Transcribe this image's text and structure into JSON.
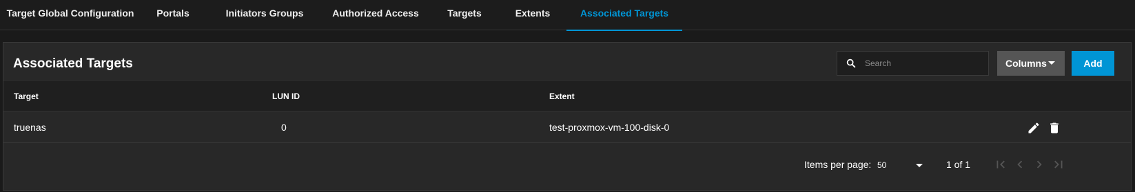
{
  "tabs": [
    {
      "label": "Target Global Configuration",
      "active": false
    },
    {
      "label": "Portals",
      "active": false
    },
    {
      "label": "Initiators Groups",
      "active": false
    },
    {
      "label": "Authorized Access",
      "active": false
    },
    {
      "label": "Targets",
      "active": false
    },
    {
      "label": "Extents",
      "active": false
    },
    {
      "label": "Associated Targets",
      "active": true
    }
  ],
  "card": {
    "title": "Associated Targets",
    "search": {
      "placeholder": "Search",
      "value": ""
    },
    "columns_label": "Columns",
    "add_label": "Add"
  },
  "table": {
    "headers": [
      "Target",
      "LUN ID",
      "Extent"
    ],
    "rows": [
      {
        "target": "truenas",
        "lun_id": "0",
        "extent": "test-proxmox-vm-100-disk-0"
      }
    ]
  },
  "paginator": {
    "items_per_page_label": "Items per page:",
    "items_per_page": "50",
    "range": "1 of 1"
  },
  "colors": {
    "accent": "#0095d5",
    "background": "#1a1a1a",
    "card": "#282828",
    "header_row": "#1f1f1f",
    "columns_button": "#555555"
  },
  "icons": [
    "search-icon",
    "chevron-down-icon",
    "edit-icon",
    "delete-icon",
    "first-page-icon",
    "previous-page-icon",
    "next-page-icon",
    "last-page-icon"
  ]
}
